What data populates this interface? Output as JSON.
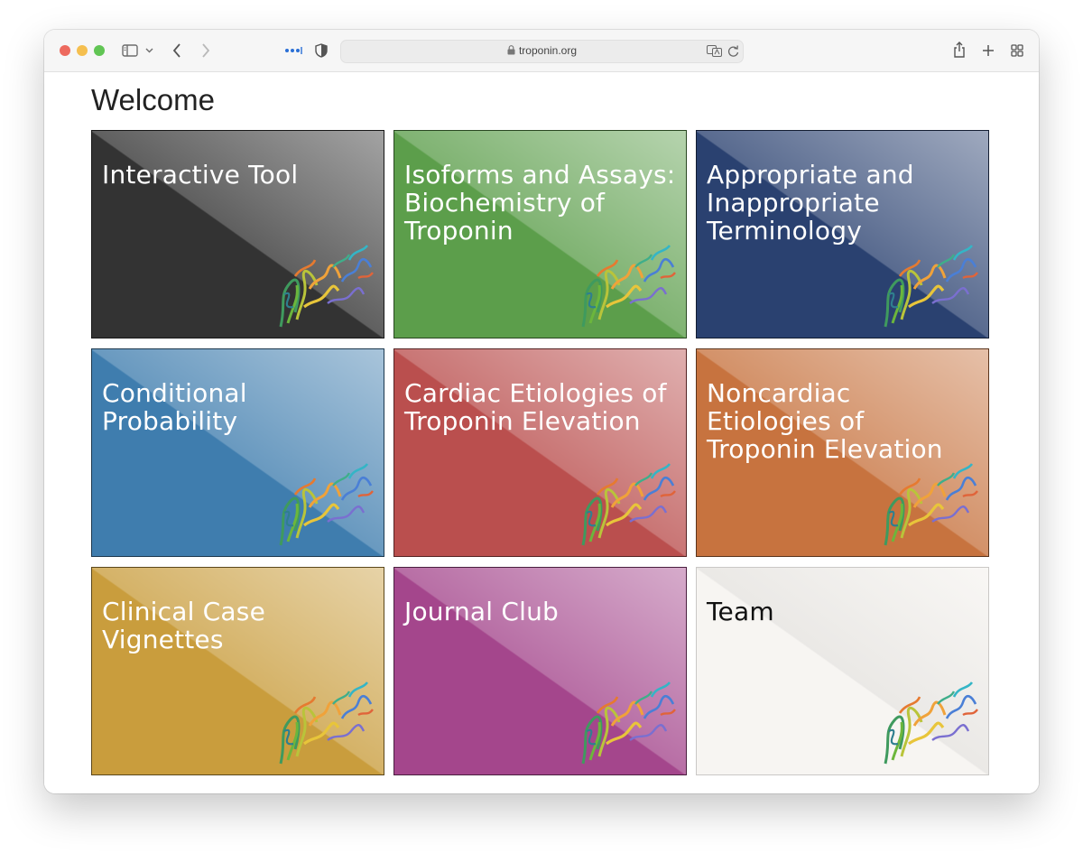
{
  "browser": {
    "url": "troponin.org"
  },
  "page": {
    "heading": "Welcome"
  },
  "tiles": [
    {
      "title": "Interactive Tool",
      "color": "#333333"
    },
    {
      "title": "Isoforms and Assays: Biochemistry of Troponin",
      "color": "#5c9e4b"
    },
    {
      "title": "Appropriate and Inappropriate Terminology",
      "color": "#2a4170"
    },
    {
      "title": "Conditional Probability",
      "color": "#3f7dae"
    },
    {
      "title": "Cardiac Etiologies of Troponin Elevation",
      "color": "#ba4f4e"
    },
    {
      "title": "Noncardiac Etiologies of Troponin Elevation",
      "color": "#c7733f"
    },
    {
      "title": "Clinical Case Vignettes",
      "color": "#c99d3d"
    },
    {
      "title": "Journal Club",
      "color": "#a4468c"
    },
    {
      "title": "Team",
      "color": "#f7f5f2"
    }
  ]
}
